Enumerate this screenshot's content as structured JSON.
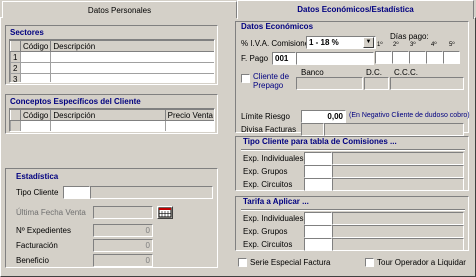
{
  "tabs": [
    {
      "label": "Datos Personales"
    },
    {
      "label": "Datos Económicos/Estadística"
    }
  ],
  "sectores": {
    "title": "Sectores",
    "columns": [
      "Código",
      "Descripción"
    ],
    "rows": [
      "1",
      "2",
      "3"
    ]
  },
  "conceptos": {
    "title": "Conceptos Específicos del Cliente",
    "columns": [
      "Código",
      "Descripción",
      "Precio Venta"
    ]
  },
  "estadistica": {
    "title": "Estadística",
    "tipo_cliente_label": "Tipo Cliente",
    "ultima_fecha_label": "Última Fecha Venta",
    "expedientes_label": "Nº Expedientes",
    "expedientes_value": "0",
    "facturacion_label": "Facturación",
    "facturacion_value": "0",
    "beneficio_label": "Beneficio",
    "beneficio_value": "0"
  },
  "economicos": {
    "title": "Datos Económicos",
    "iva_label": "% I.V.A. Comisiones",
    "iva_value": "1 - 18 %",
    "dias_pago_label": "Días pago:",
    "dias_pago_cols": [
      "1º",
      "2º",
      "3º",
      "4º",
      "5º"
    ],
    "fpago_label": "F. Pago",
    "fpago_value": "001",
    "prepago_label": "Cliente de Prepago",
    "banco_label": "Banco",
    "dc_label": "D.C.",
    "ccc_label": "C.C.C.",
    "limite_label": "Límite Riesgo",
    "limite_value": "0,00",
    "limite_note": "(En Negativo Cliente de dudoso cobro)",
    "divisa_label": "Divisa Facturas"
  },
  "tipo_cliente_comisiones": {
    "title": "Tipo Cliente para tabla de Comisiones ...",
    "rows": [
      "Exp. Individuales",
      "Exp. Grupos",
      "Exp. Circuitos"
    ]
  },
  "tarifa": {
    "title": "Tarifa a Aplicar ...",
    "rows": [
      "Exp. Individuales",
      "Exp. Grupos",
      "Exp. Circuitos"
    ]
  },
  "footer": {
    "serie_especial_label": "Serie Especial Factura",
    "tour_operador_label": "Tour Operador a Liquidar"
  }
}
